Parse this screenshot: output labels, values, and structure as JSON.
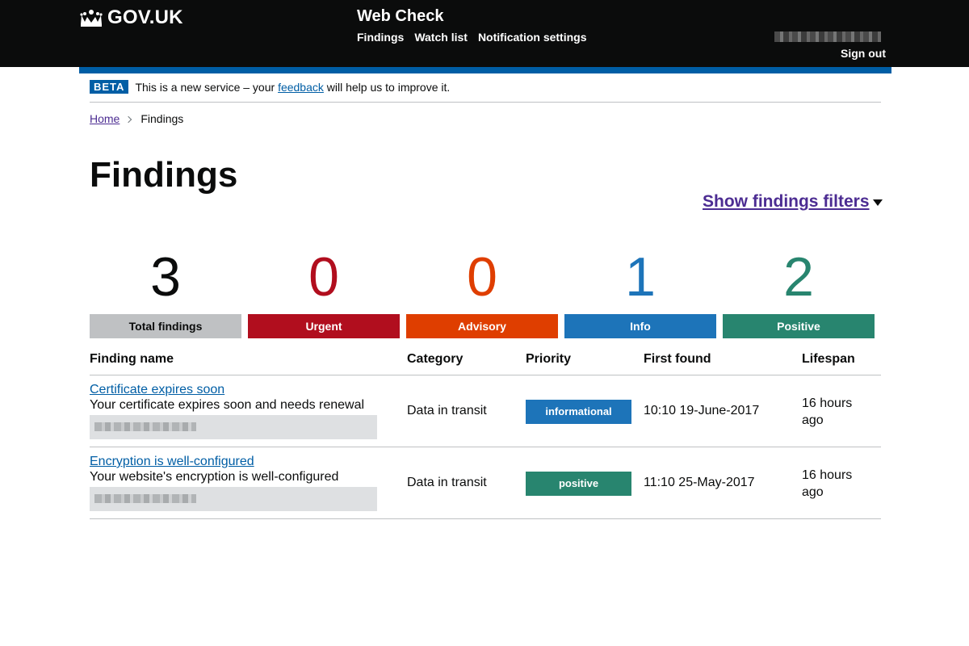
{
  "header": {
    "logo_text": "GOV.UK",
    "service_name": "Web Check",
    "nav": [
      "Findings",
      "Watch list",
      "Notification settings"
    ],
    "sign_out": "Sign out"
  },
  "beta": {
    "tag": "BETA",
    "text_before": "This is a new service – your ",
    "link": "feedback",
    "text_after": " will help us to improve it."
  },
  "breadcrumb": {
    "home": "Home",
    "current": "Findings"
  },
  "page": {
    "title": "Findings",
    "filters_link": "Show findings filters"
  },
  "summary": [
    {
      "count": "3",
      "label": "Total findings",
      "color": "#0b0c0c",
      "bg": "#bfc1c3",
      "label_color": "#0b0c0c"
    },
    {
      "count": "0",
      "label": "Urgent",
      "color": "#b10e1e",
      "bg": "#b10e1e",
      "label_color": "#ffffff"
    },
    {
      "count": "0",
      "label": "Advisory",
      "color": "#df3e00",
      "bg": "#df3e00",
      "label_color": "#ffffff"
    },
    {
      "count": "1",
      "label": "Info",
      "color": "#1d74b9",
      "bg": "#1d74b9",
      "label_color": "#ffffff"
    },
    {
      "count": "2",
      "label": "Positive",
      "color": "#28856f",
      "bg": "#28856f",
      "label_color": "#ffffff"
    }
  ],
  "table": {
    "headers": [
      "Finding name",
      "Category",
      "Priority",
      "First found",
      "Lifespan"
    ],
    "rows": [
      {
        "name": "Certificate expires soon",
        "description": "Your certificate expires soon and needs renewal",
        "category": "Data in transit",
        "priority": "informational",
        "priority_color": "#1d74b9",
        "first_found": "10:10 19-June-2017",
        "lifespan_line1": "16 hours",
        "lifespan_line2": "ago"
      },
      {
        "name": "Encryption is well-configured",
        "description": "Your website's encryption is well-configured",
        "category": "Data in transit",
        "priority": "positive",
        "priority_color": "#28856f",
        "first_found": "11:10 25-May-2017",
        "lifespan_line1": "16 hours",
        "lifespan_line2": "ago"
      }
    ]
  },
  "colors": {
    "header_bg": "#0b0c0c",
    "blue_bar": "#005ea5",
    "link": "#005ea5",
    "visited_link": "#4c2c92"
  },
  "icons": {
    "logo": "crown-icon",
    "filter_toggle": "caret-down-icon",
    "breadcrumb_separator": "chevron-right-icon"
  }
}
